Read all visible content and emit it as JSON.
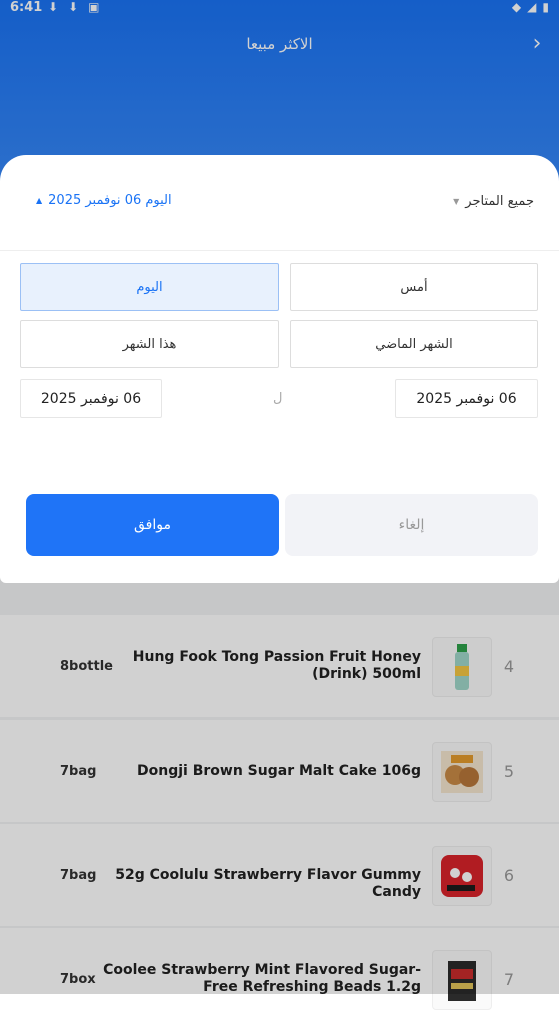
{
  "status_bar": {
    "time": "6:41"
  },
  "header": {
    "title": "الاكثر مبيعا"
  },
  "filters": {
    "date_label": "اليوم 06 نوفمبر 2025",
    "store_label": "جميع المتاجر"
  },
  "options": {
    "today": "اليوم",
    "yesterday": "أمس",
    "this_month": "هذا الشهر",
    "last_month": "الشهر الماضي",
    "selected": "today"
  },
  "range": {
    "start": "06 نوفمبر 2025",
    "end": "06 نوفمبر 2025",
    "separator": "ل"
  },
  "actions": {
    "confirm": "موافق",
    "cancel": "إلغاء"
  },
  "list": {
    "rows": [
      {
        "rank": "4",
        "name": "Hung Fook Tong Passion Fruit Honey (Drink) 500ml",
        "qty": "8bottle"
      },
      {
        "rank": "5",
        "name": "Dongji Brown Sugar Malt Cake 106g",
        "qty": "7bag"
      },
      {
        "rank": "6",
        "name": "52g Coolulu Strawberry Flavor Gummy Candy",
        "qty": "7bag"
      },
      {
        "rank": "7",
        "name": "Coolee Strawberry Mint Flavored Sugar-Free Refreshing Beads 1.2g",
        "qty": "7box"
      }
    ]
  },
  "colors": {
    "accent": "#1f74f7",
    "header_top": "#1a73f5"
  }
}
